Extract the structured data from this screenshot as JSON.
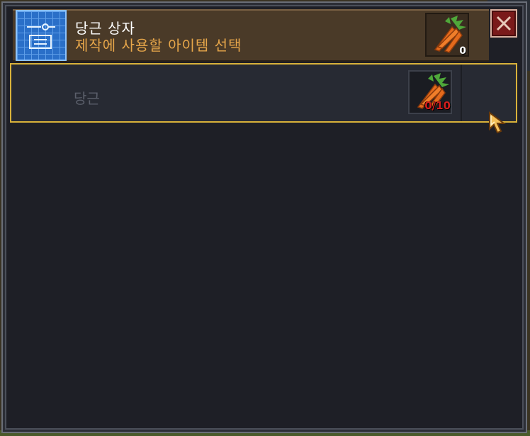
{
  "header": {
    "title": "당근 상자",
    "subtitle": "제작에 사용할 아이템 선택",
    "result_icon": "carrot-bundle-icon",
    "result_count": "0"
  },
  "close_icon": "close-x-icon",
  "recipes": [
    {
      "label": "당근",
      "ingredient_icon": "carrot-icon",
      "ingredient_count": "0/10"
    }
  ],
  "colors": {
    "title": "#ffffff",
    "subtitle": "#e8a74a",
    "selection_border": "#d9b23a",
    "count_insufficient": "#d11e1e",
    "close_button": "#7a1a1a"
  }
}
